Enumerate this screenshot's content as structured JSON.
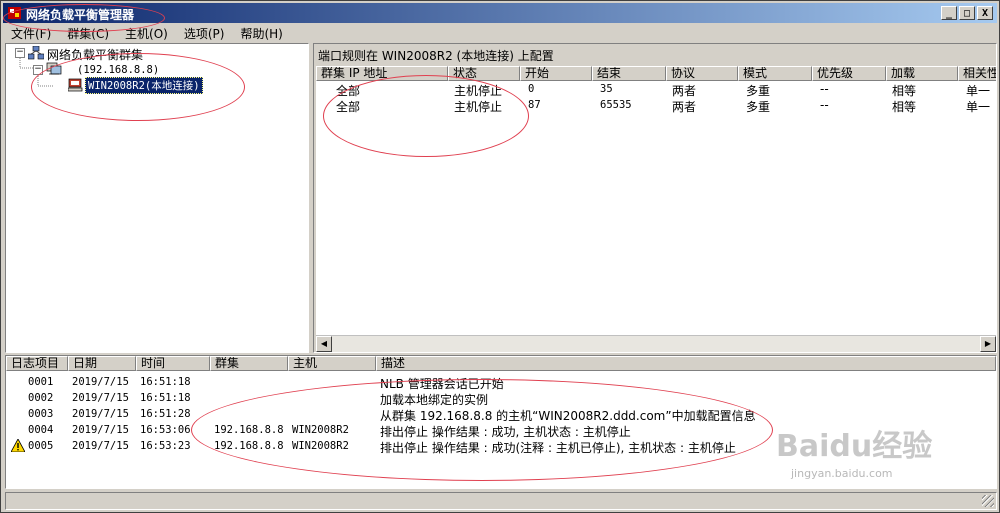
{
  "window": {
    "title": "网络负载平衡管理器",
    "buttons": [
      "_",
      "□",
      "X"
    ]
  },
  "menu": [
    "文件(F)",
    "群集(C)",
    "主机(O)",
    "选项(P)",
    "帮助(H)"
  ],
  "tree": {
    "root": "网络负载平衡群集",
    "cluster": "(192.168.8.8)",
    "host": "WIN2008R2(本地连接)"
  },
  "rules": {
    "header": "端口规则在 WIN2008R2 (本地连接) 上配置",
    "columns": [
      "群集 IP 地址",
      "状态",
      "开始",
      "结束",
      "协议",
      "模式",
      "优先级",
      "加载",
      "相关性"
    ],
    "rows": [
      [
        "全部",
        "主机停止",
        "0",
        "35",
        "两者",
        "多重",
        "--",
        "相等",
        "单一"
      ],
      [
        "全部",
        "主机停止",
        "87",
        "65535",
        "两者",
        "多重",
        "--",
        "相等",
        "单一"
      ]
    ]
  },
  "log": {
    "columns": [
      "日志项目",
      "日期",
      "时间",
      "群集",
      "主机",
      "描述"
    ],
    "rows": [
      {
        "id": "0001",
        "date": "2019/7/15",
        "time": "16:51:18",
        "cluster": "",
        "host": "",
        "desc": "NLB 管理器会话已开始",
        "warning": false
      },
      {
        "id": "0002",
        "date": "2019/7/15",
        "time": "16:51:18",
        "cluster": "",
        "host": "",
        "desc": "加载本地绑定的实例",
        "warning": false
      },
      {
        "id": "0003",
        "date": "2019/7/15",
        "time": "16:51:28",
        "cluster": "",
        "host": "",
        "desc": "从群集 192.168.8.8 的主机“WIN2008R2.ddd.com”中加载配置信息",
        "warning": false
      },
      {
        "id": "0004",
        "date": "2019/7/15",
        "time": "16:53:06",
        "cluster": "192.168.8.8",
        "host": "WIN2008R2",
        "desc": "排出停止 操作结果 : 成功, 主机状态 : 主机停止",
        "warning": false
      },
      {
        "id": "0005",
        "date": "2019/7/15",
        "time": "16:53:23",
        "cluster": "192.168.8.8",
        "host": "WIN2008R2",
        "desc": "排出停止 操作结果 : 成功(注释 : 主机已停止), 主机状态 : 主机停止",
        "warning": true
      }
    ]
  },
  "watermark": {
    "brand": "Baidu经验",
    "url": "jingyan.baidu.com"
  },
  "colors": {
    "title_start": "#0a246a",
    "title_end": "#a6caf0",
    "annotation": "#e04050",
    "selection": "#0a246a"
  }
}
